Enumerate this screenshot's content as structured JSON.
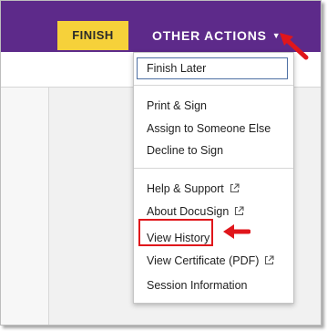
{
  "toolbar": {
    "finish_label": "FINISH",
    "other_actions_label": "OTHER ACTIONS",
    "caret": "▼"
  },
  "menu": {
    "group1": [
      "Finish Later"
    ],
    "group2": [
      "Print & Sign",
      "Assign to Someone Else",
      "Decline to Sign"
    ],
    "group3": [
      "Help & Support",
      "About DocuSign",
      "View History",
      "View Certificate (PDF)",
      "Session Information"
    ]
  },
  "icons": {
    "external_link": "external-link-icon",
    "caret": "caret-down-icon",
    "annotation_arrow": "red-arrow-icon"
  },
  "colors": {
    "topbar": "#5d2a8a",
    "finish_button": "#f6d13a",
    "highlight": "#e0161b",
    "focus_border": "#4d6fa3"
  }
}
